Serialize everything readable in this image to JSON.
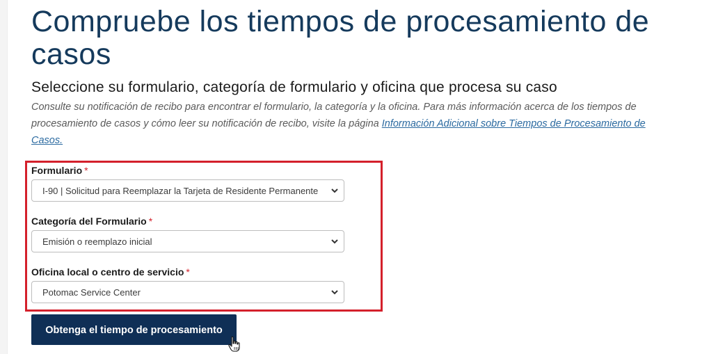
{
  "page": {
    "title": "Compruebe los tiempos de procesamiento de casos",
    "subtitle": "Seleccione su formulario, categoría de formulario y oficina que procesa su caso",
    "intro_text": "Consulte su notificación de recibo para encontrar el formulario, la categoría y la oficina. Para más información acerca de los tiempos de procesamiento de casos y cómo leer su notificación de recibo, visite la página ",
    "intro_link": "Información Adicional sobre Tiempos de Procesamiento de Casos."
  },
  "form": {
    "required_marker": "*",
    "form_field": {
      "label": "Formulario",
      "value": "I-90 | Solicitud para Reemplazar la Tarjeta de Residente Permanente"
    },
    "category_field": {
      "label": "Categoría del Formulario",
      "value": "Emisión o reemplazo inicial"
    },
    "office_field": {
      "label": "Oficina local o centro de servicio",
      "value": "Potomac Service Center"
    },
    "submit_label": "Obtenga el tiempo de procesamiento"
  },
  "colors": {
    "title": "#153a5c",
    "highlight_border": "#d4202b",
    "button_bg": "#0f2f56",
    "link": "#2b6aa0"
  },
  "icons": {
    "select_arrow": "chevron-down-icon",
    "pointer": "hand-pointer-cursor-icon"
  }
}
